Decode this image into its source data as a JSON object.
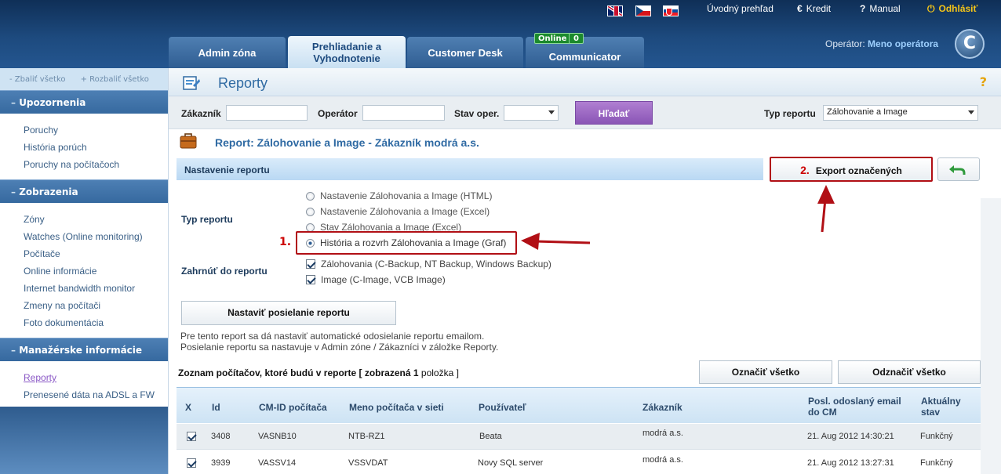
{
  "top": {
    "links": [
      "Úvodný prehľad",
      "Kredit",
      "Manual",
      "Odhlásiť"
    ],
    "tabs": [
      "Admin zóna",
      "Prehliadanie a Vyhodnotenie",
      "Customer Desk",
      "Communicator"
    ],
    "online_label": "Online",
    "online_count": "0",
    "operator_label": "Operátor:",
    "operator_name": "Meno operátora",
    "logo": "C"
  },
  "sidebar": {
    "collapse_all": "- Zbaliť všetko",
    "expand_all": "+ Rozbaliť všetko",
    "sections": [
      {
        "title": "Upozornenia",
        "items": [
          "Poruchy",
          "História porúch",
          "Poruchy na počítačoch"
        ]
      },
      {
        "title": "Zobrazenia",
        "items": [
          "Zóny",
          "Watches (Online monitoring)",
          "Počítače",
          "Online informácie",
          "Internet bandwidth monitor",
          "Zmeny na počítači",
          "Foto dokumentácia"
        ]
      },
      {
        "title": "Manažérske informácie",
        "items": [
          "Reporty",
          "Prenesené dáta na ADSL a FW"
        ]
      }
    ]
  },
  "page": {
    "title": "Reporty",
    "help": "?"
  },
  "filters": {
    "customer_label": "Zákazník",
    "operator_label": "Operátor",
    "status_label": "Stav oper.",
    "search_button": "Hľadať",
    "report_type_label": "Typ reportu",
    "report_type_value": "Zálohovanie a Image"
  },
  "report": {
    "title": "Report: Zálohovanie a Image - Zákazník modrá a.s.",
    "settings_header": "Nastavenie reportu",
    "export_number": "2.",
    "export_button": "Export označených",
    "type_label": "Typ reportu",
    "options": [
      "Nastavenie Zálohovania a Image (HTML)",
      "Nastavenie Zálohovania a Image (Excel)",
      "Stav Zálohovania a Image (Excel)",
      "História a rozvrh Zálohovania a Image (Graf)"
    ],
    "selected_number": "1.",
    "include_label": "Zahrnúť do reportu",
    "include_options": [
      "Zálohovania (C-Backup, NT Backup, Windows Backup)",
      "Image (C-Image, VCB Image)"
    ],
    "send_button": "Nastaviť posielanie reportu",
    "note_line1": "Pre tento report sa dá nastaviť automatické odosielanie reportu emailom.",
    "note_line2": "Posielanie reportu sa nastavuje v Admin zóne / Zákazníci v záložke Reporty."
  },
  "list": {
    "title": "Zoznam počítačov, ktoré budú v reporte",
    "shown_prefix": "[ zobrazená",
    "shown_count": "1",
    "shown_suffix": "položka ]",
    "mark_all": "Označiť všetko",
    "unmark_all": "Odznačiť všetko",
    "columns": [
      "X",
      "Id",
      "CM-ID počítača",
      "Meno počítača v sieti",
      "Používateľ",
      "Zákazník",
      "Posl. odoslaný email do CM",
      "Aktuálny stav"
    ],
    "rows": [
      [
        "3408",
        "VASNB10",
        "NTB-RZ1",
        "Beata",
        "modrá a.s.",
        "21. Aug 2012 14:30:21",
        "Funkčný"
      ],
      [
        "3939",
        "VASSV14",
        "VSSVDAT",
        "Novy SQL server",
        "modrá a.s.",
        "21. Aug 2012 13:27:31",
        "Funkčný"
      ]
    ]
  }
}
